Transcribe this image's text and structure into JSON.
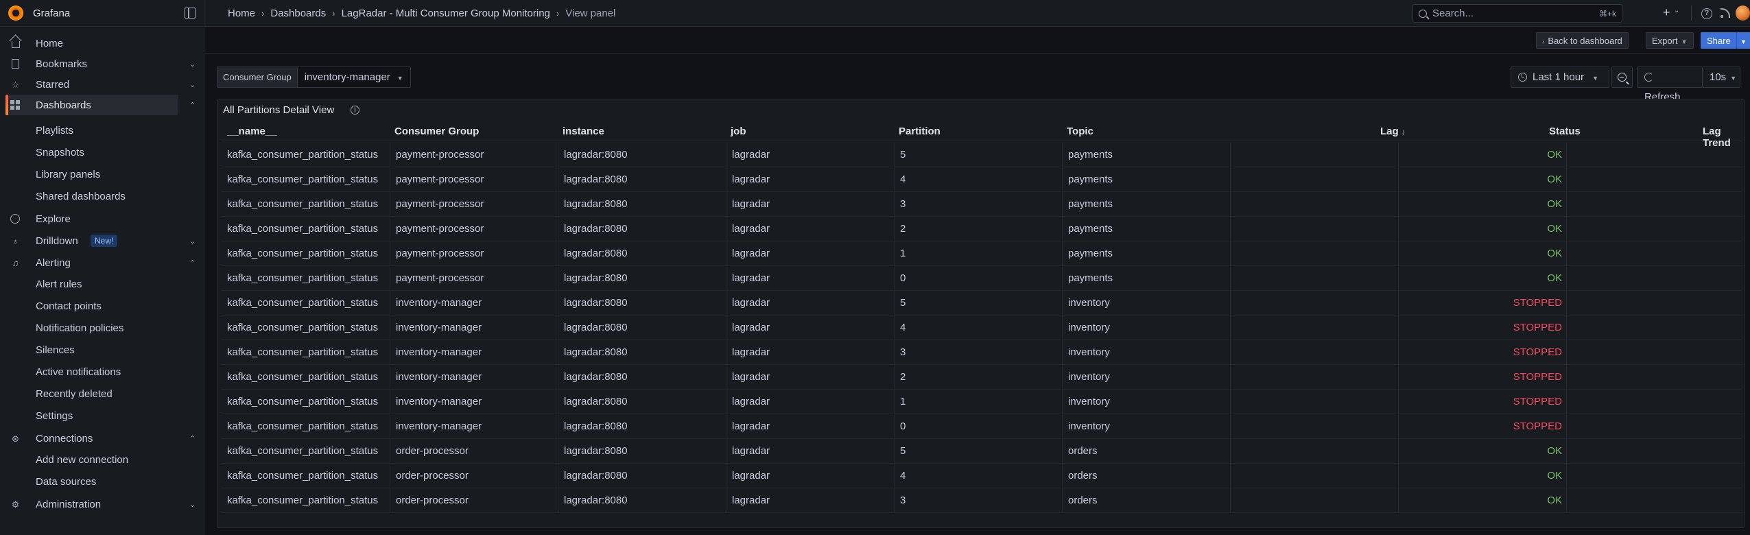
{
  "app": {
    "name": "Grafana"
  },
  "breadcrumb": [
    {
      "label": "Home"
    },
    {
      "label": "Dashboards"
    },
    {
      "label": "LagRadar - Multi Consumer Group Monitoring"
    },
    {
      "label": "View panel"
    }
  ],
  "search": {
    "placeholder": "Search...",
    "shortcut": "⌘+k"
  },
  "sidebar": {
    "items": [
      {
        "label": "Home",
        "icon": "home-icon"
      },
      {
        "label": "Bookmarks",
        "icon": "bookmark-icon",
        "expanded": false
      },
      {
        "label": "Starred",
        "icon": "star-icon",
        "expanded": false
      },
      {
        "label": "Dashboards",
        "icon": "apps-icon",
        "expanded": true,
        "active": true
      },
      {
        "label": "Explore",
        "icon": "compass-icon"
      },
      {
        "label": "Drilldown",
        "icon": "microscope-icon",
        "badge": "New!",
        "expanded": false
      },
      {
        "label": "Alerting",
        "icon": "bell-icon",
        "expanded": true
      },
      {
        "label": "Connections",
        "icon": "link-icon",
        "expanded": true
      },
      {
        "label": "Administration",
        "icon": "cog-icon",
        "expanded": false
      }
    ],
    "dashboards_children": [
      "Playlists",
      "Snapshots",
      "Library panels",
      "Shared dashboards"
    ],
    "alerting_children": [
      "Alert rules",
      "Contact points",
      "Notification policies",
      "Silences",
      "Active notifications",
      "Recently deleted",
      "Settings"
    ],
    "connections_children": [
      "Add new connection",
      "Data sources"
    ]
  },
  "toolbar": {
    "back_label": "Back to dashboard",
    "export_label": "Export",
    "share_label": "Share"
  },
  "variables": {
    "consumer_group": {
      "label": "Consumer Group",
      "value": "inventory-manager"
    }
  },
  "time": {
    "range_label": "Last 1 hour",
    "refresh_label": "Refresh",
    "refresh_interval": "10s"
  },
  "panel": {
    "title": "All Partitions Detail View",
    "columns": [
      "__name__",
      "Consumer Group",
      "instance",
      "job",
      "Partition",
      "Topic",
      "Lag",
      "Status",
      "Lag Trend"
    ],
    "sorted_column": "Lag",
    "sort_direction": "descending",
    "rows": [
      {
        "name": "kafka_consumer_partition_status",
        "group": "payment-processor",
        "instance": "lagradar:8080",
        "job": "lagradar",
        "partition": "5",
        "topic": "payments",
        "lag": "",
        "status": "OK"
      },
      {
        "name": "kafka_consumer_partition_status",
        "group": "payment-processor",
        "instance": "lagradar:8080",
        "job": "lagradar",
        "partition": "4",
        "topic": "payments",
        "lag": "",
        "status": "OK"
      },
      {
        "name": "kafka_consumer_partition_status",
        "group": "payment-processor",
        "instance": "lagradar:8080",
        "job": "lagradar",
        "partition": "3",
        "topic": "payments",
        "lag": "",
        "status": "OK"
      },
      {
        "name": "kafka_consumer_partition_status",
        "group": "payment-processor",
        "instance": "lagradar:8080",
        "job": "lagradar",
        "partition": "2",
        "topic": "payments",
        "lag": "",
        "status": "OK"
      },
      {
        "name": "kafka_consumer_partition_status",
        "group": "payment-processor",
        "instance": "lagradar:8080",
        "job": "lagradar",
        "partition": "1",
        "topic": "payments",
        "lag": "",
        "status": "OK"
      },
      {
        "name": "kafka_consumer_partition_status",
        "group": "payment-processor",
        "instance": "lagradar:8080",
        "job": "lagradar",
        "partition": "0",
        "topic": "payments",
        "lag": "",
        "status": "OK"
      },
      {
        "name": "kafka_consumer_partition_status",
        "group": "inventory-manager",
        "instance": "lagradar:8080",
        "job": "lagradar",
        "partition": "5",
        "topic": "inventory",
        "lag": "",
        "status": "STOPPED"
      },
      {
        "name": "kafka_consumer_partition_status",
        "group": "inventory-manager",
        "instance": "lagradar:8080",
        "job": "lagradar",
        "partition": "4",
        "topic": "inventory",
        "lag": "",
        "status": "STOPPED"
      },
      {
        "name": "kafka_consumer_partition_status",
        "group": "inventory-manager",
        "instance": "lagradar:8080",
        "job": "lagradar",
        "partition": "3",
        "topic": "inventory",
        "lag": "",
        "status": "STOPPED"
      },
      {
        "name": "kafka_consumer_partition_status",
        "group": "inventory-manager",
        "instance": "lagradar:8080",
        "job": "lagradar",
        "partition": "2",
        "topic": "inventory",
        "lag": "",
        "status": "STOPPED"
      },
      {
        "name": "kafka_consumer_partition_status",
        "group": "inventory-manager",
        "instance": "lagradar:8080",
        "job": "lagradar",
        "partition": "1",
        "topic": "inventory",
        "lag": "",
        "status": "STOPPED"
      },
      {
        "name": "kafka_consumer_partition_status",
        "group": "inventory-manager",
        "instance": "lagradar:8080",
        "job": "lagradar",
        "partition": "0",
        "topic": "inventory",
        "lag": "",
        "status": "STOPPED"
      },
      {
        "name": "kafka_consumer_partition_status",
        "group": "order-processor",
        "instance": "lagradar:8080",
        "job": "lagradar",
        "partition": "5",
        "topic": "orders",
        "lag": "",
        "status": "OK"
      },
      {
        "name": "kafka_consumer_partition_status",
        "group": "order-processor",
        "instance": "lagradar:8080",
        "job": "lagradar",
        "partition": "4",
        "topic": "orders",
        "lag": "",
        "status": "OK"
      },
      {
        "name": "kafka_consumer_partition_status",
        "group": "order-processor",
        "instance": "lagradar:8080",
        "job": "lagradar",
        "partition": "3",
        "topic": "orders",
        "lag": "",
        "status": "OK"
      }
    ]
  },
  "colors": {
    "status_ok": "#73bf69",
    "status_stopped": "#f2495c",
    "accent": "#3d71d9",
    "brand": "#f46800"
  }
}
